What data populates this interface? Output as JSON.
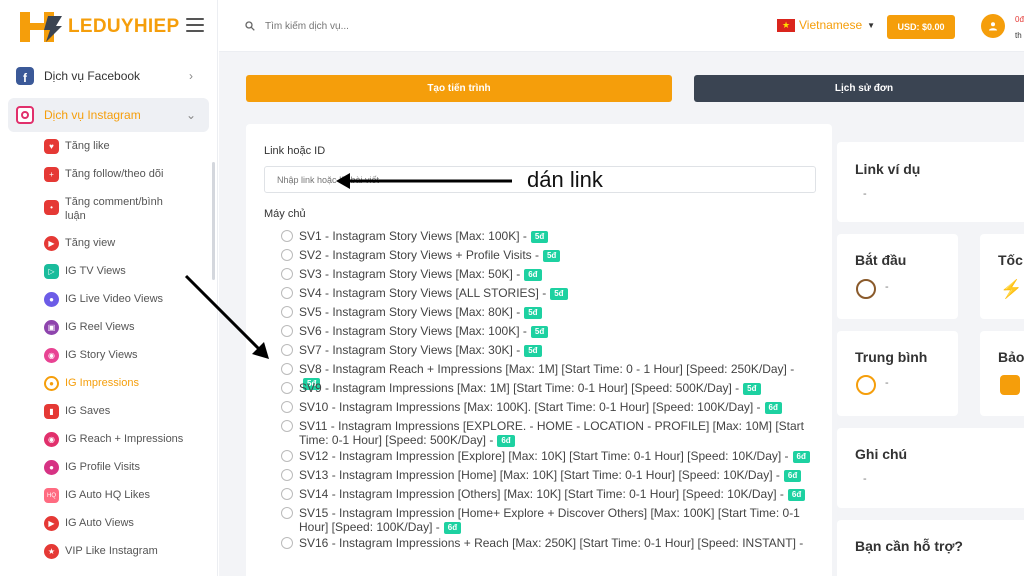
{
  "brand": {
    "name": "LEDUYHIEP"
  },
  "sidebar": {
    "groups": [
      {
        "label": "Dịch vụ Facebook",
        "icon": "facebook-icon"
      },
      {
        "label": "Dịch vụ Instagram",
        "icon": "instagram-icon"
      }
    ],
    "items": [
      {
        "label": "Tăng like",
        "icon": "heart-icon"
      },
      {
        "label": "Tăng follow/theo dõi",
        "icon": "user-plus-icon"
      },
      {
        "label": "Tăng comment/bình luận",
        "icon": "comment-icon"
      },
      {
        "label": "Tăng view",
        "icon": "play-icon"
      },
      {
        "label": "IG TV Views",
        "icon": "tv-icon"
      },
      {
        "label": "IG Live Video Views",
        "icon": "live-video-icon"
      },
      {
        "label": "IG Reel Views",
        "icon": "reel-icon"
      },
      {
        "label": "IG Story Views",
        "icon": "story-icon"
      },
      {
        "label": "IG Impressions",
        "icon": "eye-icon"
      },
      {
        "label": "IG Saves",
        "icon": "bookmark-icon"
      },
      {
        "label": "IG Reach + Impressions",
        "icon": "reach-icon"
      },
      {
        "label": "IG Profile Visits",
        "icon": "profile-icon"
      },
      {
        "label": "IG Auto HQ Likes",
        "icon": "hq-like-icon"
      },
      {
        "label": "IG Auto Views",
        "icon": "auto-view-icon"
      },
      {
        "label": "VIP Like Instagram",
        "icon": "vip-icon"
      }
    ]
  },
  "topbar": {
    "search_placeholder": "Tìm kiếm dịch vụ...",
    "language": "Vietnamese",
    "balance_button": "USD: $0.00",
    "user_line1": "0đ",
    "user_line2": "th"
  },
  "actions": {
    "create": "Tạo tiến trình",
    "history": "Lịch sử đơn"
  },
  "form": {
    "link_label": "Link hoặc ID",
    "link_placeholder": "Nhập link hoặc ID bài viết",
    "server_label": "Máy chủ",
    "servers": [
      {
        "text": "SV1 - Instagram Story Views [Max: 100K] -",
        "badge": "5đ"
      },
      {
        "text": "SV2 - Instagram Story Views + Profile Visits -",
        "badge": "5đ"
      },
      {
        "text": "SV3 - Instagram Story Views [Max: 50K] -",
        "badge": "6đ"
      },
      {
        "text": "SV4 - Instagram Story Views [ALL STORIES] -",
        "badge": "5đ"
      },
      {
        "text": "SV5 - Instagram Story Views [Max: 80K] -",
        "badge": "5đ"
      },
      {
        "text": "SV6 - Instagram Story Views [Max: 100K] -",
        "badge": "5đ"
      },
      {
        "text": "SV7 - Instagram Story Views [Max: 30K] -",
        "badge": "5đ"
      },
      {
        "text": "SV8 - Instagram Reach + Impressions [Max: 1M] [Start Time: 0 - 1 Hour] [Speed: 250K/Day] -",
        "badge": "5đ"
      },
      {
        "text": "SV9 - Instagram Impressions [Max: 1M] [Start Time: 0-1 Hour] [Speed: 500K/Day] -",
        "badge": "5đ"
      },
      {
        "text": "SV10 - Instagram Impressions [Max: 100K]. [Start Time: 0-1 Hour] [Speed: 100K/Day] -",
        "badge": "6đ"
      },
      {
        "text": "SV11 - Instagram Impressions [EXPLORE. - HOME - LOCATION - PROFILE] [Max: 10M] [Start Time: 0-1 Hour] [Speed: 500K/Day] -",
        "badge": "6đ"
      },
      {
        "text": "SV12 - Instagram Impression [Explore] [Max: 10K] [Start Time: 0-1 Hour] [Speed: 10K/Day] -",
        "badge": "6đ"
      },
      {
        "text": "SV13 - Instagram Impression [Home] [Max: 10K] [Start Time: 0-1 Hour] [Speed: 10K/Day] -",
        "badge": "6đ"
      },
      {
        "text": "SV14 - Instagram Impression [Others] [Max: 10K] [Start Time: 0-1 Hour] [Speed: 10K/Day] -",
        "badge": "6đ"
      },
      {
        "text": "SV15 - Instagram Impression [Home+ Explore + Discover Others] [Max: 100K] [Start Time: 0-1 Hour] [Speed: 100K/Day] -",
        "badge": "6đ"
      },
      {
        "text": "SV16 - Instagram Impressions + Reach [Max: 250K] [Start Time: 0-1 Hour] [Speed: INSTANT] -",
        "badge": ""
      }
    ]
  },
  "side_cards": {
    "link_example": {
      "title": "Link ví dụ",
      "value": "-"
    },
    "start": {
      "title": "Bắt đầu",
      "value": "-"
    },
    "speed": {
      "title": "Tốc"
    },
    "average": {
      "title": "Trung bình",
      "value": "-"
    },
    "warranty": {
      "title": "Bảo"
    },
    "note": {
      "title": "Ghi chú",
      "value": "-"
    },
    "support": {
      "title": "Bạn cần hỗ trợ?"
    }
  },
  "annotation": {
    "text": "dán link"
  },
  "colors": {
    "accent": "#f59e0b",
    "dark_button": "#3a4452",
    "badge": "#1dd1a1"
  }
}
